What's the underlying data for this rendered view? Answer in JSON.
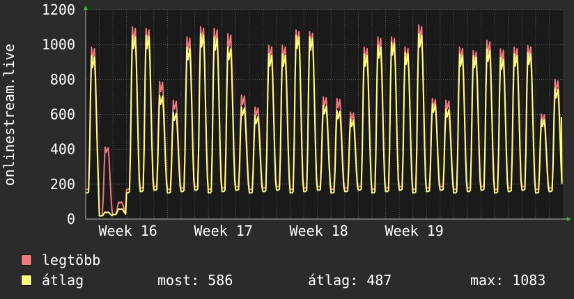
{
  "chart_data": {
    "type": "line",
    "ylabel": "onlinestream.live",
    "ylim": [
      0,
      1200
    ],
    "yticks": [
      0,
      200,
      400,
      600,
      800,
      1000,
      1200
    ],
    "x_tick_labels": [
      "Week 16",
      "Week 17",
      "Week 18",
      "Week 19"
    ],
    "grid": true,
    "colors": {
      "background": "#2b2b2b",
      "plot_bg": "#1a1a1a",
      "grid": "#5a5a5a",
      "max": "#f07a7e",
      "avg": "#ffff7f",
      "arrow": "#22cc22"
    },
    "days": 35,
    "day_peaks": [
      [
        1000,
        950
      ],
      [
        420,
        40
      ],
      [
        100,
        60
      ],
      [
        1120,
        1070
      ],
      [
        1110,
        1070
      ],
      [
        800,
        720
      ],
      [
        690,
        620
      ],
      [
        1060,
        1000
      ],
      [
        1120,
        1080
      ],
      [
        1110,
        1060
      ],
      [
        1080,
        1000
      ],
      [
        720,
        650
      ],
      [
        650,
        600
      ],
      [
        1010,
        960
      ],
      [
        1010,
        960
      ],
      [
        1100,
        1070
      ],
      [
        1090,
        1060
      ],
      [
        710,
        660
      ],
      [
        700,
        630
      ],
      [
        620,
        580
      ],
      [
        1000,
        960
      ],
      [
        1060,
        1010
      ],
      [
        1060,
        1030
      ],
      [
        1000,
        970
      ],
      [
        1130,
        1080
      ],
      [
        700,
        670
      ],
      [
        690,
        640
      ],
      [
        1000,
        960
      ],
      [
        980,
        950
      ],
      [
        1040,
        990
      ],
      [
        990,
        940
      ],
      [
        1000,
        960
      ],
      [
        1010,
        970
      ],
      [
        610,
        580
      ],
      [
        810,
        760
      ]
    ],
    "series": [
      {
        "name": "legtöbb"
      },
      {
        "name": "átlag",
        "last": 586
      }
    ]
  },
  "legend": {
    "max_label": "legtöbb",
    "avg_label": "átlag",
    "now_text": "most: 586",
    "avg_text": "átlag: 487",
    "max_text": "max: 1083"
  }
}
